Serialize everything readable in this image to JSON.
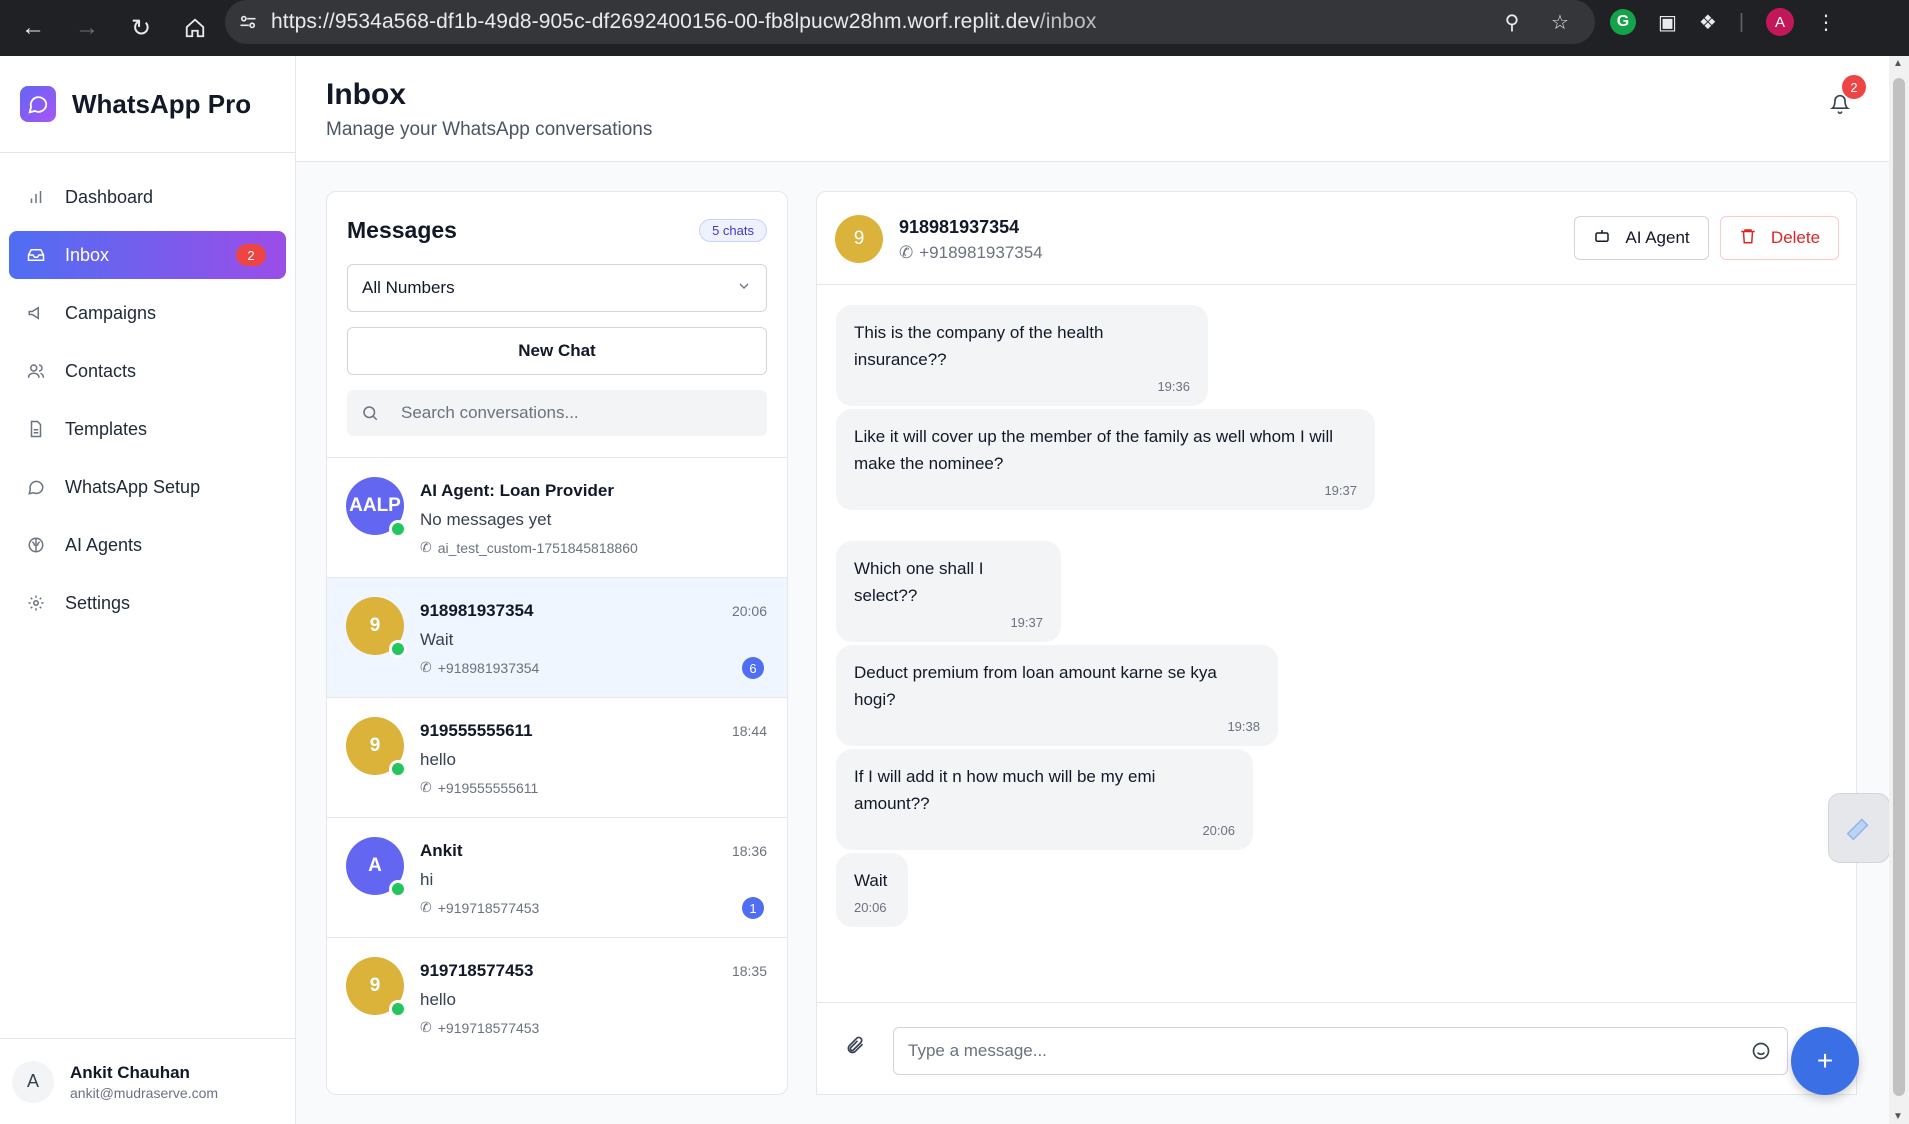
{
  "browser": {
    "url_host": "https://9534a568-df1b-49d8-905c-df2692400156-00-fb8lpucw28hm.worf.replit.dev",
    "url_path": "/inbox",
    "profile_initial": "A"
  },
  "sidebar": {
    "brand": "WhatsApp Pro",
    "items": [
      {
        "label": "Dashboard",
        "icon": "bar-chart-icon"
      },
      {
        "label": "Inbox",
        "icon": "inbox-icon",
        "badge": "2"
      },
      {
        "label": "Campaigns",
        "icon": "megaphone-icon"
      },
      {
        "label": "Contacts",
        "icon": "users-icon"
      },
      {
        "label": "Templates",
        "icon": "file-text-icon"
      },
      {
        "label": "WhatsApp Setup",
        "icon": "message-circle-icon"
      },
      {
        "label": "AI Agents",
        "icon": "brain-icon"
      },
      {
        "label": "Settings",
        "icon": "gear-icon"
      }
    ],
    "user": {
      "initial": "A",
      "name": "Ankit Chauhan",
      "email": "ankit@mudraserve.com"
    }
  },
  "header": {
    "title": "Inbox",
    "subtitle": "Manage your WhatsApp conversations",
    "notification_count": "2"
  },
  "conversations": {
    "title": "Messages",
    "count_chip": "5 chats",
    "filter_value": "All Numbers",
    "new_chat_label": "New Chat",
    "search_placeholder": "Search conversations...",
    "items": [
      {
        "avatar": "AALP",
        "avatar_color": "#6366f1",
        "name": "AI Agent: Loan Provider",
        "time": "",
        "preview": "No messages yet",
        "phone": "ai_test_custom-1751845818860",
        "badge": ""
      },
      {
        "avatar": "9",
        "avatar_color": "#dbb23a",
        "name": "918981937354",
        "time": "20:06",
        "preview": "Wait",
        "phone": "+918981937354",
        "badge": "6"
      },
      {
        "avatar": "9",
        "avatar_color": "#dbb23a",
        "name": "919555555611",
        "time": "18:44",
        "preview": "hello",
        "phone": "+919555555611",
        "badge": ""
      },
      {
        "avatar": "A",
        "avatar_color": "#6366f1",
        "name": "Ankit",
        "time": "18:36",
        "preview": "hi",
        "phone": "+919718577453",
        "badge": "1"
      },
      {
        "avatar": "9",
        "avatar_color": "#dbb23a",
        "name": "919718577453",
        "time": "18:35",
        "preview": "hello",
        "phone": "+919718577453",
        "badge": ""
      }
    ]
  },
  "chat": {
    "avatar": "9",
    "name": "918981937354",
    "phone": "+918981937354",
    "ai_agent_label": "AI Agent",
    "delete_label": "Delete",
    "messages": [
      {
        "text": "This is the company of the health insurance??",
        "time": "19:36"
      },
      {
        "text": "Like it will cover up the member of the family as well whom I will make the nominee?",
        "time": "19:37"
      },
      {
        "text": "Which one shall I select??",
        "time": "19:37"
      },
      {
        "text": "Deduct premium from loan amount karne se kya hogi?",
        "time": "19:38"
      },
      {
        "text": "If I will add it n how much will be my emi amount??",
        "time": "20:06"
      },
      {
        "text": "Wait",
        "time": "20:06"
      }
    ],
    "compose_placeholder": "Type a message..."
  },
  "fab_label": "+"
}
